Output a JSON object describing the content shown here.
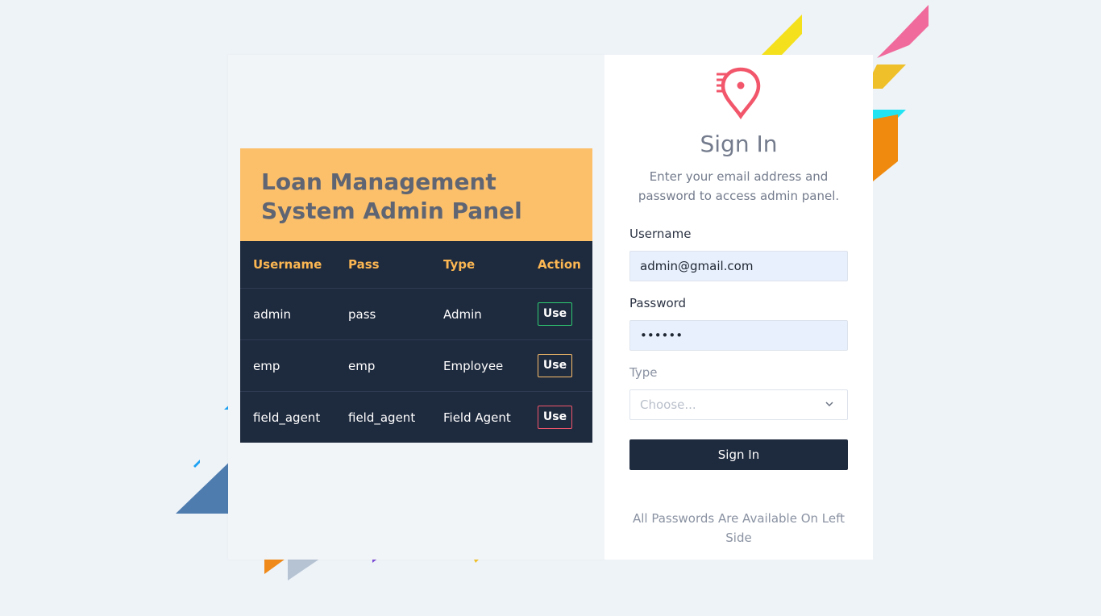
{
  "colors": {
    "accent": "#fcc06b",
    "dark": "#1e2a3e",
    "logo": "#f2566b",
    "use_admin": "#2ecc71",
    "use_employee": "#fcc06b",
    "use_field_agent": "#f2566b"
  },
  "credentials": {
    "title": "Loan Management System Admin Panel",
    "headers": [
      "Username",
      "Pass",
      "Type",
      "Action"
    ],
    "rows": [
      {
        "username": "admin",
        "pass": "pass",
        "type": "Admin",
        "action": "Use"
      },
      {
        "username": "emp",
        "pass": "emp",
        "type": "Employee",
        "action": "Use"
      },
      {
        "username": "field_agent",
        "pass": "field_agent",
        "type": "Field Agent",
        "action": "Use"
      }
    ]
  },
  "signin": {
    "logo_icon": "location-pin-speed-icon",
    "title": "Sign In",
    "subtitle": "Enter your email address and password to access admin panel.",
    "username_label": "Username",
    "username_value": "admin@gmail.com",
    "password_label": "Password",
    "password_value": "••••••",
    "type_label": "Type",
    "type_placeholder": "Choose...",
    "button_label": "Sign In",
    "note": "All Passwords Are Available On Left Side"
  }
}
